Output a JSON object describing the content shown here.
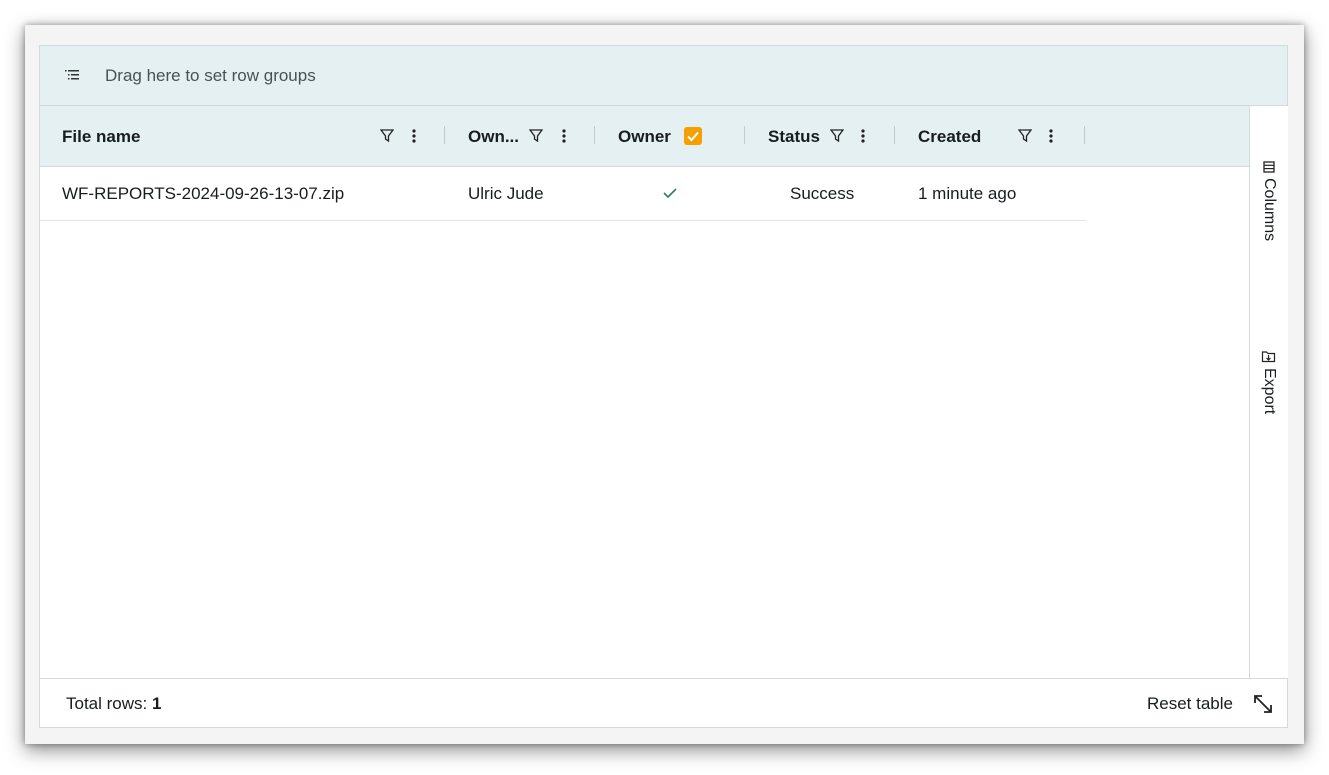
{
  "group_panel": {
    "icon": "row-group-icon",
    "placeholder": "Drag here to set row groups"
  },
  "columns": [
    {
      "label": "File name",
      "filter_icon": "filter-icon",
      "menu_icon": "kebab-menu-icon"
    },
    {
      "label": "Own...",
      "filter_icon": "filter-icon",
      "menu_icon": "kebab-menu-icon"
    },
    {
      "label": "Owner",
      "checkbox_icon": "checkbox-checked-icon",
      "checkbox_color": "#f5a000"
    },
    {
      "label": "Status",
      "filter_icon": "filter-icon",
      "menu_icon": "kebab-menu-icon"
    },
    {
      "label": "Created",
      "filter_icon": "filter-icon",
      "menu_icon": "kebab-menu-icon"
    }
  ],
  "rows": [
    {
      "file_name": "WF-REPORTS-2024-09-26-13-07.zip",
      "owner_name": "Ulric Jude",
      "owner_check_icon": "check-icon",
      "status": "Success",
      "created": "1 minute ago"
    }
  ],
  "side_bar": {
    "columns_label": "Columns",
    "columns_icon": "columns-icon",
    "export_label": "Export",
    "export_icon": "export-icon"
  },
  "footer": {
    "total_label": "Total rows:",
    "total_value": "1",
    "reset_label": "Reset table",
    "expand_icon": "expand-diagonal-icon"
  },
  "colors": {
    "header_bg": "#e4f0f2",
    "accent": "#f5a000",
    "check_green": "#2e7d5b"
  }
}
